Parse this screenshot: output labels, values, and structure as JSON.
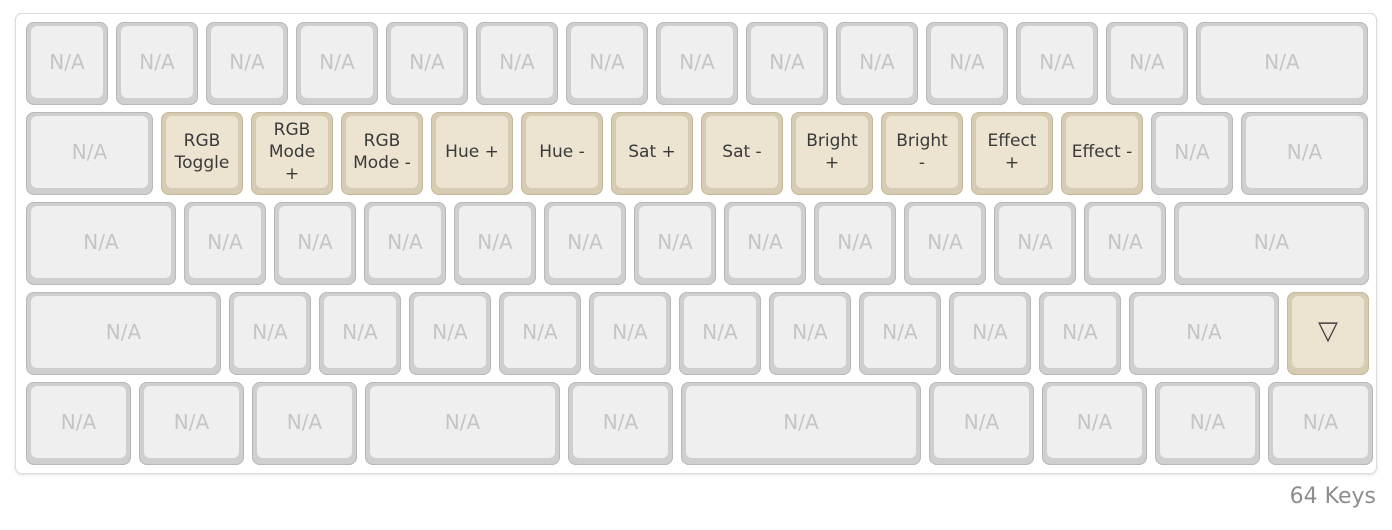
{
  "keyboard": {
    "rows": [
      {
        "keys": [
          {
            "label": "N/A",
            "w": 1,
            "active": false
          },
          {
            "label": "N/A",
            "w": 1,
            "active": false
          },
          {
            "label": "N/A",
            "w": 1,
            "active": false
          },
          {
            "label": "N/A",
            "w": 1,
            "active": false
          },
          {
            "label": "N/A",
            "w": 1,
            "active": false
          },
          {
            "label": "N/A",
            "w": 1,
            "active": false
          },
          {
            "label": "N/A",
            "w": 1,
            "active": false
          },
          {
            "label": "N/A",
            "w": 1,
            "active": false
          },
          {
            "label": "N/A",
            "w": 1,
            "active": false
          },
          {
            "label": "N/A",
            "w": 1,
            "active": false
          },
          {
            "label": "N/A",
            "w": 1,
            "active": false
          },
          {
            "label": "N/A",
            "w": 1,
            "active": false
          },
          {
            "label": "N/A",
            "w": 1,
            "active": false
          },
          {
            "label": "N/A",
            "w": 2,
            "active": false
          }
        ]
      },
      {
        "keys": [
          {
            "label": "N/A",
            "w": 1.5,
            "active": false
          },
          {
            "label": "RGB\nToggle",
            "w": 1,
            "active": true
          },
          {
            "label": "RGB\nMode\n+",
            "w": 1,
            "active": true
          },
          {
            "label": "RGB\nMode -",
            "w": 1,
            "active": true
          },
          {
            "label": "Hue +",
            "w": 1,
            "active": true
          },
          {
            "label": "Hue -",
            "w": 1,
            "active": true
          },
          {
            "label": "Sat +",
            "w": 1,
            "active": true
          },
          {
            "label": "Sat -",
            "w": 1,
            "active": true
          },
          {
            "label": "Bright\n+",
            "w": 1,
            "active": true
          },
          {
            "label": "Bright\n-",
            "w": 1,
            "active": true
          },
          {
            "label": "Effect\n+",
            "w": 1,
            "active": true
          },
          {
            "label": "Effect -",
            "w": 1,
            "active": true
          },
          {
            "label": "N/A",
            "w": 1,
            "active": false
          },
          {
            "label": "N/A",
            "w": 1.5,
            "active": false
          }
        ]
      },
      {
        "keys": [
          {
            "label": "N/A",
            "w": 1.75,
            "active": false
          },
          {
            "label": "N/A",
            "w": 1,
            "active": false
          },
          {
            "label": "N/A",
            "w": 1,
            "active": false
          },
          {
            "label": "N/A",
            "w": 1,
            "active": false
          },
          {
            "label": "N/A",
            "w": 1,
            "active": false
          },
          {
            "label": "N/A",
            "w": 1,
            "active": false
          },
          {
            "label": "N/A",
            "w": 1,
            "active": false
          },
          {
            "label": "N/A",
            "w": 1,
            "active": false
          },
          {
            "label": "N/A",
            "w": 1,
            "active": false
          },
          {
            "label": "N/A",
            "w": 1,
            "active": false
          },
          {
            "label": "N/A",
            "w": 1,
            "active": false
          },
          {
            "label": "N/A",
            "w": 1,
            "active": false
          },
          {
            "label": "N/A",
            "w": 2.25,
            "active": false
          }
        ]
      },
      {
        "keys": [
          {
            "label": "N/A",
            "w": 2.25,
            "active": false
          },
          {
            "label": "N/A",
            "w": 1,
            "active": false
          },
          {
            "label": "N/A",
            "w": 1,
            "active": false
          },
          {
            "label": "N/A",
            "w": 1,
            "active": false
          },
          {
            "label": "N/A",
            "w": 1,
            "active": false
          },
          {
            "label": "N/A",
            "w": 1,
            "active": false
          },
          {
            "label": "N/A",
            "w": 1,
            "active": false
          },
          {
            "label": "N/A",
            "w": 1,
            "active": false
          },
          {
            "label": "N/A",
            "w": 1,
            "active": false
          },
          {
            "label": "N/A",
            "w": 1,
            "active": false
          },
          {
            "label": "N/A",
            "w": 1,
            "active": false
          },
          {
            "label": "N/A",
            "w": 1.75,
            "active": false
          },
          {
            "label": "▽",
            "w": 1,
            "active": true,
            "icon": "triangle-down-icon"
          }
        ]
      },
      {
        "keys": [
          {
            "label": "N/A",
            "w": 1.25,
            "active": false
          },
          {
            "label": "N/A",
            "w": 1.25,
            "active": false
          },
          {
            "label": "N/A",
            "w": 1.25,
            "active": false
          },
          {
            "label": "N/A",
            "w": 2.25,
            "active": false
          },
          {
            "label": "N/A",
            "w": 1.25,
            "active": false
          },
          {
            "label": "N/A",
            "w": 2.75,
            "active": false
          },
          {
            "label": "N/A",
            "w": 1.25,
            "active": false
          },
          {
            "label": "N/A",
            "w": 1.25,
            "active": false
          },
          {
            "label": "N/A",
            "w": 1.25,
            "active": false
          },
          {
            "label": "N/A",
            "w": 1.25,
            "active": false
          }
        ]
      }
    ]
  },
  "footer": {
    "key_count": "64 Keys"
  },
  "colors": {
    "active_key": "#ece3d1",
    "inactive_key": "#efefef",
    "active_border": "#d6ccb3"
  }
}
